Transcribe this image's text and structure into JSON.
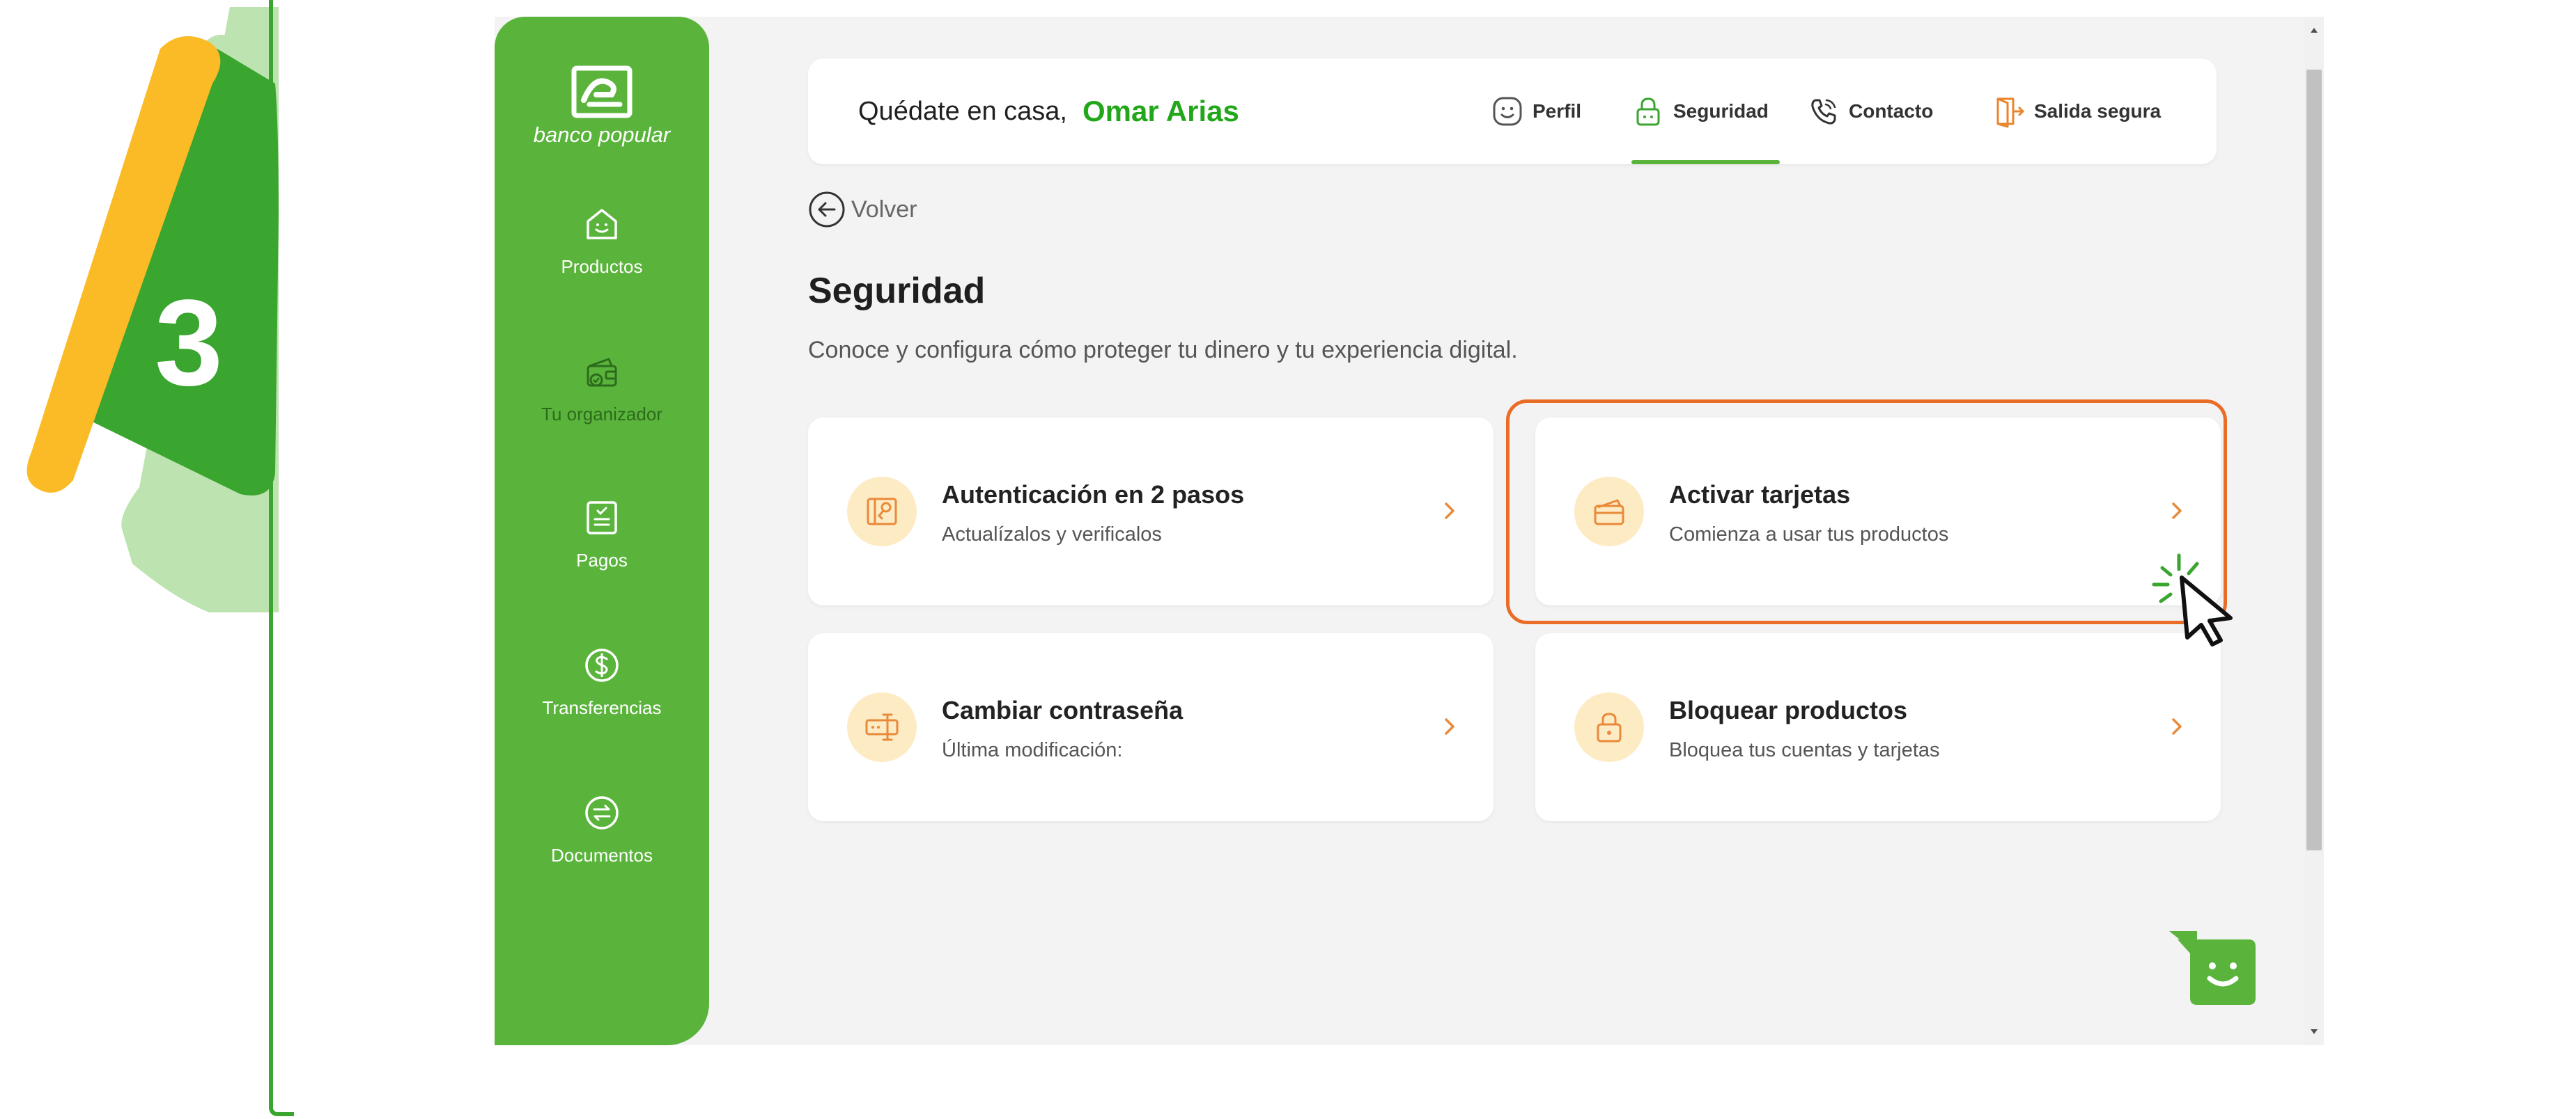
{
  "step": {
    "number": "3"
  },
  "brand": {
    "name": "banco popular"
  },
  "sidebar": {
    "items": [
      {
        "label": "Productos",
        "icon": "home-smile-icon"
      },
      {
        "label": "Tu organizador",
        "icon": "wallet-icon"
      },
      {
        "label": "Pagos",
        "icon": "receipt-icon"
      },
      {
        "label": "Transferencias",
        "icon": "dollar-circle-icon"
      },
      {
        "label": "Documentos",
        "icon": "exchange-icon"
      }
    ]
  },
  "header": {
    "greeting": "Quédate en casa,",
    "user_name": "Omar Arias",
    "links": [
      {
        "label": "Perfil",
        "icon": "smile-face-icon"
      },
      {
        "label": "Seguridad",
        "icon": "lock-icon",
        "active": true
      },
      {
        "label": "Contacto",
        "icon": "phone-icon"
      },
      {
        "label": "Salida segura",
        "icon": "door-exit-icon"
      }
    ]
  },
  "back_label": "Volver",
  "page": {
    "title": "Seguridad",
    "subtitle": "Conoce y configura cómo proteger tu dinero y tu experiencia digital."
  },
  "cards": [
    {
      "title": "Autenticación en 2 pasos",
      "desc": "Actualízalos y verificalos",
      "icon": "key-card-icon"
    },
    {
      "title": "Activar tarjetas",
      "desc": "Comienza a usar tus productos",
      "icon": "cards-icon",
      "highlighted": true
    },
    {
      "title": "Cambiar contraseña",
      "desc": "Última modificación:",
      "icon": "password-field-icon"
    },
    {
      "title": "Bloquear productos",
      "desc": "Bloquea tus cuentas y tarjetas",
      "icon": "lock-icon"
    }
  ],
  "colors": {
    "brand_green": "#5ab43c",
    "name_green": "#23a71a",
    "highlight_orange": "#e96c27",
    "icon_orange": "#e98a3b",
    "icon_bg": "#fdebc4",
    "badge_yellow": "#fbbb27"
  }
}
